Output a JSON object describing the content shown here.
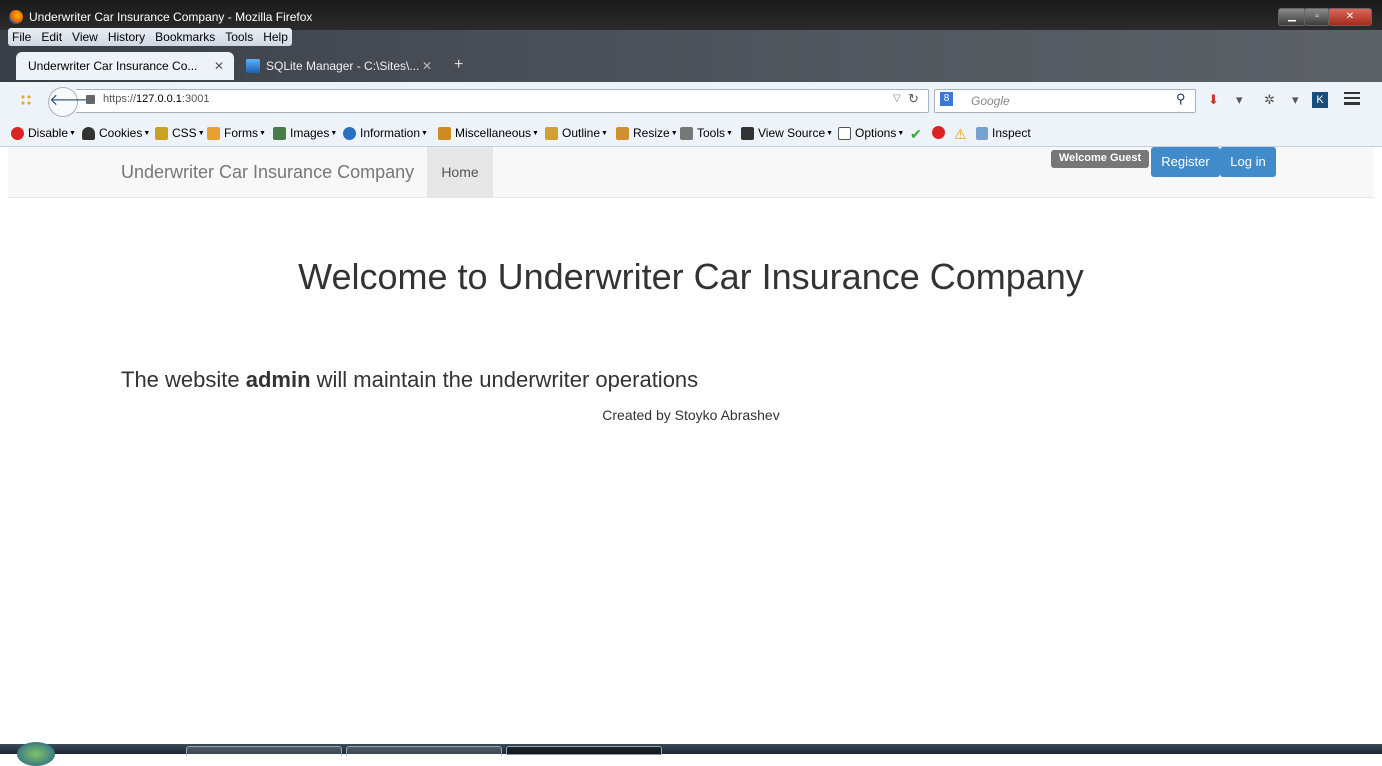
{
  "window": {
    "title": "Underwriter Car Insurance Company - Mozilla Firefox"
  },
  "menu": [
    "File",
    "Edit",
    "View",
    "History",
    "Bookmarks",
    "Tools",
    "Help"
  ],
  "tabs": [
    {
      "label": "Underwriter Car Insurance Co...",
      "active": true
    },
    {
      "label": "SQLite Manager - C:\\Sites\\...",
      "active": false
    }
  ],
  "address": {
    "prefix": "https://",
    "host": "127.0.0.1",
    "port": ":3001"
  },
  "search": {
    "placeholder": "Google"
  },
  "devtoolbar": [
    "Disable",
    "Cookies",
    "CSS",
    "Forms",
    "Images",
    "Information",
    "Miscellaneous",
    "Outline",
    "Resize",
    "Tools",
    "View Source",
    "Options",
    "Inspect"
  ],
  "site": {
    "brand": "Underwriter Car Insurance Company",
    "nav_home": "Home",
    "welcome": "Welcome Guest",
    "register": "Register",
    "login": "Log in",
    "heading": "Welcome to Underwriter Car Insurance Company",
    "lead_pre": "The website ",
    "lead_bold": "admin",
    "lead_post": " will maintain the underwriter operations",
    "credit": "Created by Stoyko Abrashev"
  },
  "colors": {
    "primary": "#428bca",
    "badge": "#777777",
    "navbar": "#f8f8f8"
  }
}
